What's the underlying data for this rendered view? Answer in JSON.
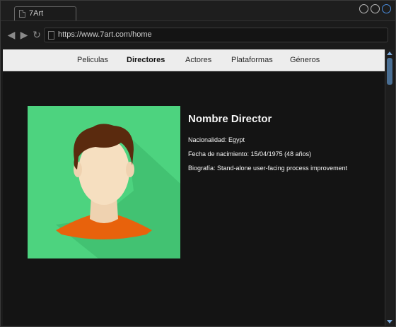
{
  "browser": {
    "tab_title": "7Art",
    "url": "https://www.7art.com/home"
  },
  "icons": {
    "back": "arrow-left-icon",
    "forward": "arrow-right-icon",
    "reload": "reload-icon",
    "page": "document-icon"
  },
  "nav": {
    "items": [
      {
        "label": "Peliculas",
        "active": false
      },
      {
        "label": "Directores",
        "active": true
      },
      {
        "label": "Actores",
        "active": false
      },
      {
        "label": "Plataformas",
        "active": false
      },
      {
        "label": "Géneros",
        "active": false
      }
    ]
  },
  "director": {
    "name": "Nombre Director",
    "nationality": "Nacionalidad: Egypt",
    "birth": "Fecha de nacimiento: 15/04/1975 (48 años)",
    "bio": "Biografía: Stand-alone user-facing process improvement"
  },
  "colors": {
    "photo_bg": "#4dd37f",
    "shirt": "#e8620c",
    "hair": "#5a2a0e",
    "skin": "#f6dfc0",
    "accent_blue": "#4a8ee0"
  }
}
